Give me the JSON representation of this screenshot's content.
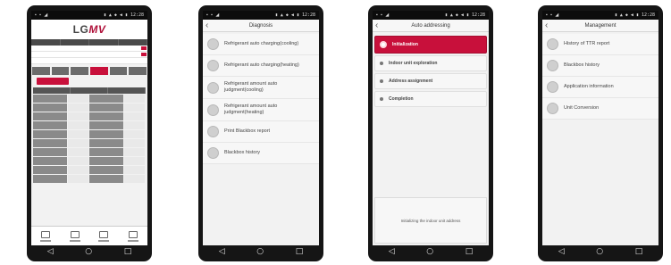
{
  "status": {
    "right": "▮ ▲ ◆ ◀ ▮ 12:28"
  },
  "nav": {
    "back": "◁",
    "home": "○",
    "recent": "□"
  },
  "phone1": {
    "logo_lg": "LG",
    "logo_mv": "MV"
  },
  "phone2": {
    "title": "Diagnosis",
    "items": [
      {
        "label": "Refrigerant auto charging(cooling)"
      },
      {
        "label": "Refrigerant auto charging(heating)"
      },
      {
        "label": "Refrigerant amount auto judgment(cooling)"
      },
      {
        "label": "Refrigerant amount auto judgment(heating)"
      },
      {
        "label": "Print Blackbox report"
      },
      {
        "label": "Blackbox history"
      }
    ]
  },
  "phone3": {
    "title": "Auto addressing",
    "steps": [
      {
        "label": "Initialization",
        "active": true
      },
      {
        "label": "Indoor unit exploration",
        "active": false
      },
      {
        "label": "Address assignment",
        "active": false
      },
      {
        "label": "Completion",
        "active": false
      }
    ],
    "progress_text": "Initializing the indoor unit address"
  },
  "phone4": {
    "title": "Management",
    "items": [
      {
        "label": "History of TTR report"
      },
      {
        "label": "Blackbox history"
      },
      {
        "label": "Application information"
      },
      {
        "label": "Unit Conversion"
      }
    ]
  },
  "colors": {
    "accent": "#c8103b",
    "dark": "#151515"
  }
}
